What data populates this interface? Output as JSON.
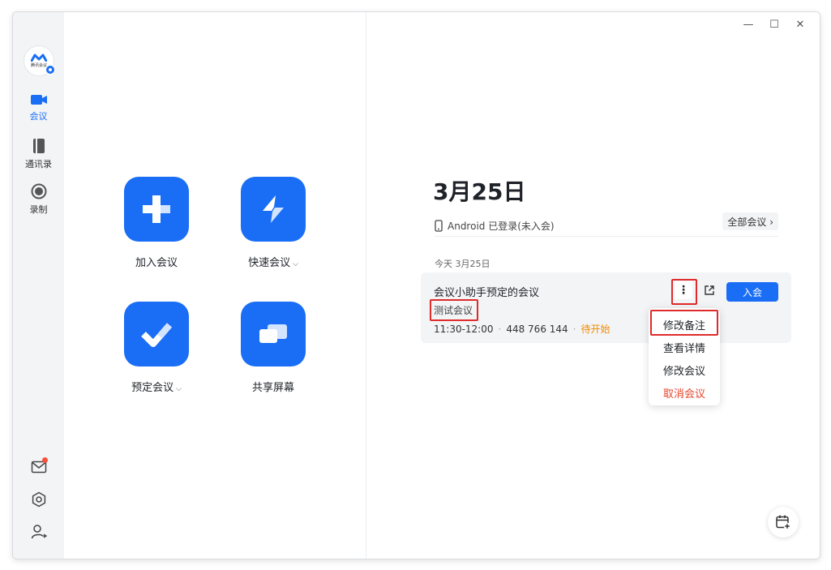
{
  "app": {
    "logo_text": "腾讯会议",
    "logo_badge": "",
    "accent": "#1a6ef5"
  },
  "sidebar": {
    "items": [
      {
        "label": "会议",
        "icon": "video-camera-icon",
        "active": true
      },
      {
        "label": "通讯录",
        "icon": "address-book-icon",
        "active": false
      },
      {
        "label": "录制",
        "icon": "record-icon",
        "active": false
      }
    ],
    "bottom_icons": [
      "mail-icon",
      "settings-icon",
      "user-switch-icon"
    ],
    "mail_has_unread": true
  },
  "actions": [
    {
      "label": "加入会议",
      "icon": "plus-icon",
      "dropdown": false
    },
    {
      "label": "快速会议",
      "icon": "lightning-icon",
      "dropdown": true
    },
    {
      "label": "预定会议",
      "icon": "check-icon",
      "dropdown": true
    },
    {
      "label": "共享屏幕",
      "icon": "screen-share-icon",
      "dropdown": false
    }
  ],
  "window_controls": {
    "minimize": "—",
    "maximize": "☐",
    "close": "✕"
  },
  "main": {
    "date_title": "3月25日",
    "status_text": "Android 已登录(未入会)",
    "all_meetings": "全部会议 ›",
    "day_label": "今天 3月25日",
    "meeting": {
      "title": "会议小助手预定的会议",
      "tag": "测试会议",
      "time": "11:30-12:00",
      "id": "448 766 144",
      "status": "待开始",
      "join_label": "入会",
      "more_glyph": "⋮"
    },
    "menu": {
      "items": [
        {
          "label": "修改备注",
          "danger": false
        },
        {
          "label": "查看详情",
          "danger": false
        },
        {
          "label": "修改会议",
          "danger": false
        },
        {
          "label": "取消会议",
          "danger": true
        }
      ]
    }
  }
}
